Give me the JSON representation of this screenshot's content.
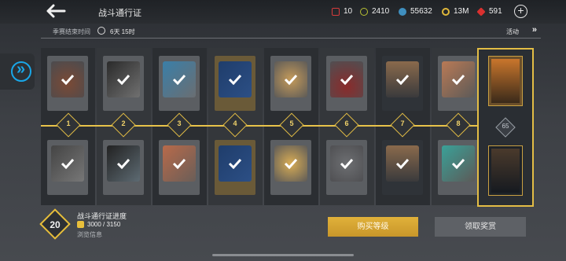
{
  "header": {
    "title": "战斗通行证",
    "back_icon": "back-arrow-icon",
    "resources": [
      {
        "name": "red-ticket",
        "value": "10",
        "color": "#d63b3b"
      },
      {
        "name": "yellow-token",
        "value": "2410",
        "color": "#b9c233"
      },
      {
        "name": "blue-token",
        "value": "55632",
        "color": "#3f8fbf"
      },
      {
        "name": "gold-coin",
        "value": "13M",
        "color": "#e0b83a"
      },
      {
        "name": "red-gem",
        "value": "591",
        "color": "#d9302f"
      }
    ],
    "add_label": "+"
  },
  "season": {
    "label": "季赛结束时间",
    "time": "6天 15时",
    "activity": "活动",
    "activity_chevron": "»"
  },
  "track": {
    "accent_color": "#e3bd45",
    "nodes": [
      "1",
      "2",
      "3",
      "4",
      "5",
      "6",
      "7",
      "8"
    ],
    "premium_node": "65"
  },
  "bottom": {
    "level": "20",
    "progress_title": "战斗通行证进度",
    "progress_value": "3000 / 3150",
    "browse_label": "浏览信息",
    "buy_button": "购买等级",
    "claim_button": "领取奖赏"
  }
}
